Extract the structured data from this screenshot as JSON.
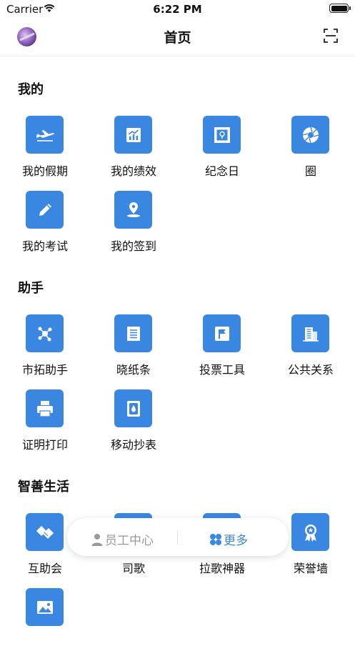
{
  "status_bar": {
    "carrier": "Carrier",
    "time": "6:22 PM"
  },
  "header": {
    "title": "首页"
  },
  "sections": [
    {
      "title": "我的",
      "items": [
        {
          "label": "我的假期",
          "icon": "airplane-icon"
        },
        {
          "label": "我的绩效",
          "icon": "chart-icon"
        },
        {
          "label": "纪念日",
          "icon": "stamp-icon"
        },
        {
          "label": "圈",
          "icon": "aperture-icon"
        },
        {
          "label": "我的考试",
          "icon": "pencil-icon"
        },
        {
          "label": "我的签到",
          "icon": "location-pin-icon"
        }
      ]
    },
    {
      "title": "助手",
      "items": [
        {
          "label": "市拓助手",
          "icon": "network-icon"
        },
        {
          "label": "晓纸条",
          "icon": "note-icon"
        },
        {
          "label": "投票工具",
          "icon": "flag-icon"
        },
        {
          "label": "公共关系",
          "icon": "building-icon"
        },
        {
          "label": "证明打印",
          "icon": "printer-icon"
        },
        {
          "label": "移动抄表",
          "icon": "water-meter-icon"
        }
      ]
    },
    {
      "title": "智善生活",
      "items": [
        {
          "label": "互助会",
          "icon": "handshake-icon"
        },
        {
          "label": "司歌",
          "icon": "music-icon"
        },
        {
          "label": "拉歌神器",
          "icon": "microphone-icon"
        },
        {
          "label": "荣誉墙",
          "icon": "award-icon"
        },
        {
          "label": "",
          "icon": "image-icon"
        }
      ]
    }
  ],
  "floating_bar": {
    "staff_label": "员工中心",
    "more_label": "更多"
  },
  "colors": {
    "accent": "#3a87e2",
    "muted": "#999999"
  }
}
